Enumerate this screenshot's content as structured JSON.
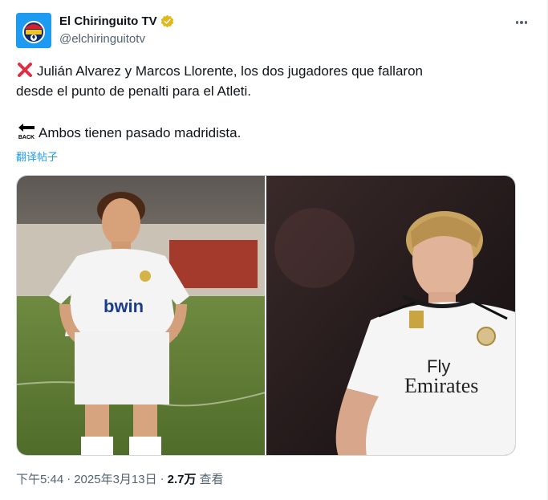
{
  "author": {
    "display_name": "El Chiringuito TV",
    "handle": "@elchiringuitotv",
    "avatar_icon": "el-chiringuito-logo",
    "verified_color": "#e2b719"
  },
  "tweet": {
    "line1": "Julián Alvarez y Marcos Llorente, los dos jugadores que fallaron",
    "line2": "desde el punto de penalti para el Atleti.",
    "line3": "Ambos tienen pasado madridista.",
    "line1_icon": "red-x-icon",
    "line3_icon": "back-arrow-icon",
    "translate_label": "翻译帖子"
  },
  "media": {
    "left_shirt_sponsor": "bwin",
    "right_shirt_sponsor_top": "Fly",
    "right_shirt_sponsor_bottom": "Emirates"
  },
  "meta": {
    "time": "下午5:44",
    "date": "2025年3月13日",
    "views_count": "2.7万",
    "views_label": "查看"
  },
  "colors": {
    "accent": "#1d9bf0",
    "secondary_text": "#536471"
  }
}
